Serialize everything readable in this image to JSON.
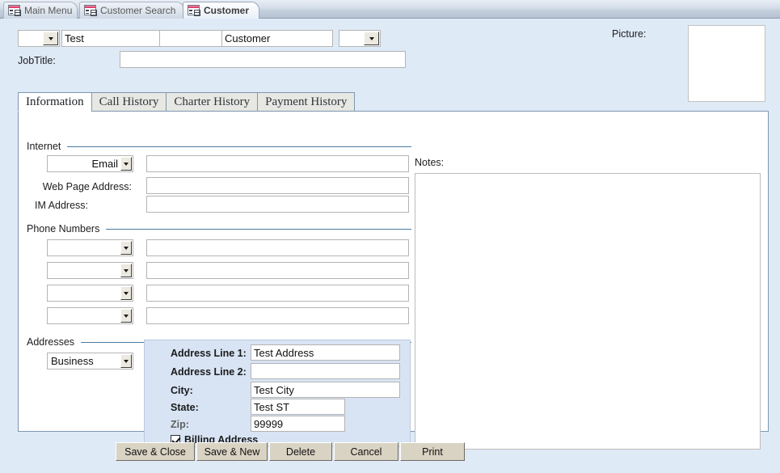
{
  "window": {
    "doc_tabs": [
      {
        "label": "Main Menu",
        "icon": "access-form-icon",
        "active": false
      },
      {
        "label": "Customer Search",
        "icon": "access-form-icon",
        "active": false
      },
      {
        "label": "Customer",
        "icon": "access-form-icon",
        "active": true
      }
    ]
  },
  "header": {
    "title_combo_value": "",
    "first_name_value": "Test",
    "middle_name_value": "",
    "last_name_value": "Customer",
    "suffix_combo_value": "",
    "jobtitle_label": "JobTitle:",
    "jobtitle_value": "",
    "picture_label": "Picture:",
    "picture_value": ""
  },
  "tabs": {
    "items": [
      {
        "label": "Information",
        "selected": true
      },
      {
        "label": "Call History",
        "selected": false
      },
      {
        "label": "Charter History",
        "selected": false
      },
      {
        "label": "Payment History",
        "selected": false
      }
    ]
  },
  "information": {
    "internet": {
      "section_label": "Internet",
      "email_type_value": "Email",
      "email_value": "",
      "web_page_label": "Web Page Address:",
      "web_page_value": "",
      "im_label": "IM Address:",
      "im_value": ""
    },
    "phone_numbers": {
      "section_label": "Phone Numbers",
      "rows": [
        {
          "type_value": "",
          "number_value": ""
        },
        {
          "type_value": "",
          "number_value": ""
        },
        {
          "type_value": "",
          "number_value": ""
        },
        {
          "type_value": "",
          "number_value": ""
        }
      ]
    },
    "addresses": {
      "section_label": "Addresses",
      "type_value": "Business",
      "address_line_1_label": "Address Line 1:",
      "address_line_1_value": "Test Address",
      "address_line_2_label": "Address Line 2:",
      "address_line_2_value": "",
      "city_label": "City:",
      "city_value": "Test City",
      "state_label": "State:",
      "state_value": "Test ST",
      "zip_label": "Zip:",
      "zip_value": "99999",
      "billing_address_label": "Billing Address",
      "billing_address_checked": true
    },
    "notes": {
      "label": "Notes:",
      "value": ""
    }
  },
  "buttons": [
    {
      "label": "Save & Close"
    },
    {
      "label": "Save & New"
    },
    {
      "label": "Delete"
    },
    {
      "label": "Cancel"
    },
    {
      "label": "Print"
    }
  ],
  "colors": {
    "form_background": "#dfeaf7",
    "tab_border": "#7e97b0",
    "section_rule": "#4a7ba0",
    "address_panel": "#d8e4f4",
    "button_face": "#d9d3c3"
  }
}
